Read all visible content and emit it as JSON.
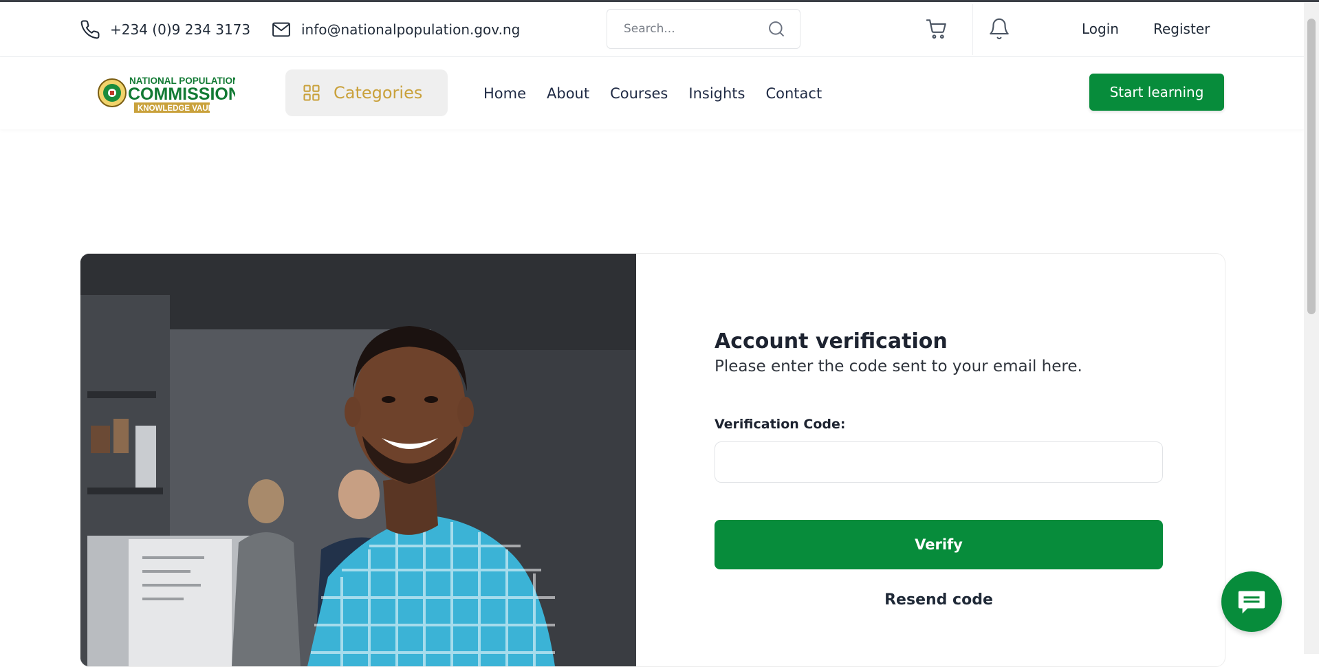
{
  "topbar": {
    "phone": "+234 (0)9 234 3173",
    "email": "info@nationalpopulation.gov.ng",
    "search_placeholder": "Search...",
    "login_label": "Login",
    "register_label": "Register"
  },
  "nav": {
    "logo": {
      "line1": "NATIONAL POPULATION",
      "line2": "COMMISSION",
      "line3": "KNOWLEDGE VAULT"
    },
    "categories_label": "Categories",
    "links": [
      "Home",
      "About",
      "Courses",
      "Insights",
      "Contact"
    ],
    "cta_label": "Start learning"
  },
  "verification": {
    "title": "Account verification",
    "subtitle": "Please enter the code sent to your email here.",
    "code_label": "Verification Code:",
    "code_value": "",
    "verify_label": "Verify",
    "resend_label": "Resend code"
  },
  "colors": {
    "primary_green": "#078c3b",
    "gold": "#c9a13b",
    "text_dark": "#1f2937"
  },
  "icons": {
    "phone": "phone-icon",
    "email": "mail-icon",
    "search": "search-icon",
    "cart": "cart-icon",
    "notifications": "bell-icon",
    "categories": "grid-icon",
    "chat": "chat-icon"
  }
}
